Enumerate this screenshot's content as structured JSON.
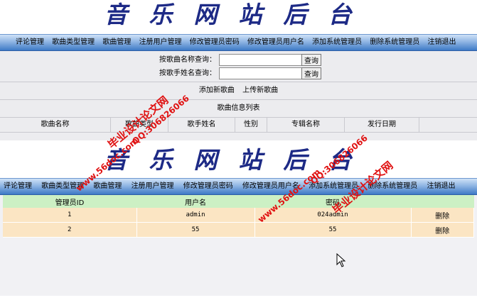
{
  "site": {
    "title": "音乐网站后台"
  },
  "nav": {
    "items": [
      "评论管理",
      "歌曲类型管理",
      "歌曲管理",
      "注册用户管理",
      "修改管理员密码",
      "修改管理员用户名",
      "添加系统管理员",
      "删除系统管理员",
      "注销退出"
    ]
  },
  "search": {
    "song_name_label": "按歌曲名称查询：",
    "singer_label": "按歌手姓名查询：",
    "song_name_value": "",
    "singer_value": "",
    "button_label": "查询"
  },
  "actions": {
    "add_song": "添加新歌曲",
    "upload_song": "上传新歌曲"
  },
  "song_list": {
    "title": "歌曲信息列表",
    "columns": [
      "歌曲名称",
      "歌曲类型",
      "歌手姓名",
      "性别",
      "专辑名称",
      "发行日期"
    ]
  },
  "admin_table": {
    "columns": [
      "管理员ID",
      "用户名",
      "密码",
      ""
    ],
    "rows": [
      {
        "id": "1",
        "username": "admin",
        "password": "024admin",
        "action": "删除"
      },
      {
        "id": "2",
        "username": "55",
        "password": "55",
        "action": "删除"
      }
    ]
  },
  "watermarks": {
    "brand": "毕业设计论文网",
    "site": "www.56doc.com",
    "qq": "QQ:306826066"
  },
  "colors": {
    "title": "#1d2a86",
    "nav_top": "#cfe2f7",
    "nav_bottom": "#3d7ac6",
    "table_header": "#ccf0c4",
    "table_row": "#fbe5c3",
    "watermark": "#e01212"
  }
}
